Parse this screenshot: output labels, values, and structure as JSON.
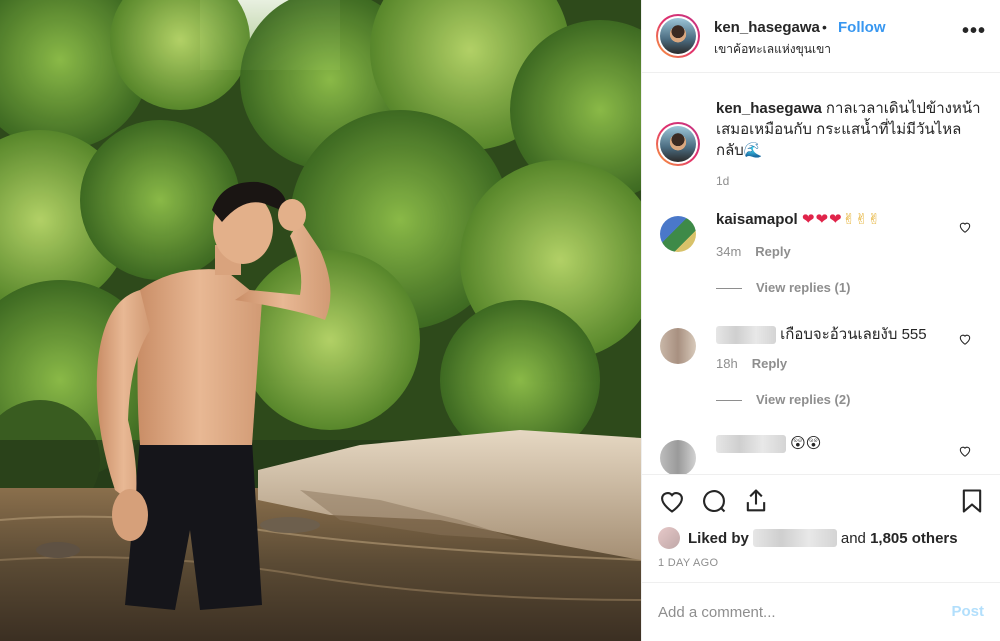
{
  "post": {
    "username": "ken_hasegawa",
    "separator": "•",
    "follow_label": "Follow",
    "location": "เขาค้อทะเลแห่งขุนเขา",
    "more_icon": "more-horizontal-icon"
  },
  "caption": {
    "username": "ken_hasegawa",
    "text": "กาลเวลาเดินไปข้างหน้าเสมอเหมือนกับ กระแสน้ำที่ไม่มีวันไหลกลับ🌊",
    "time": "1d"
  },
  "comments": [
    {
      "username": "kaisamapol",
      "text": "❤❤❤",
      "text2": "✌✌✌",
      "time": "34m",
      "reply_label": "Reply",
      "view_replies": "View replies (1)"
    },
    {
      "username": "",
      "text": "เกือบจะอ้วนเลยงับ 555",
      "time": "18h",
      "reply_label": "Reply",
      "view_replies": "View replies (2)"
    },
    {
      "username": "",
      "text": "😲😲"
    }
  ],
  "actions": {
    "like_icon": "heart-icon",
    "comment_icon": "comment-icon",
    "share_icon": "share-icon",
    "save_icon": "bookmark-icon"
  },
  "likes": {
    "prefix": "Liked by",
    "and_text": "and",
    "others": "1,805 others"
  },
  "post_time": "1 DAY AGO",
  "add_comment": {
    "placeholder": "Add a comment...",
    "post_label": "Post"
  },
  "colors": {
    "link_blue": "#3897f0",
    "post_disabled": "#b2dffc",
    "muted": "#8e8e8e",
    "text": "#262626"
  }
}
